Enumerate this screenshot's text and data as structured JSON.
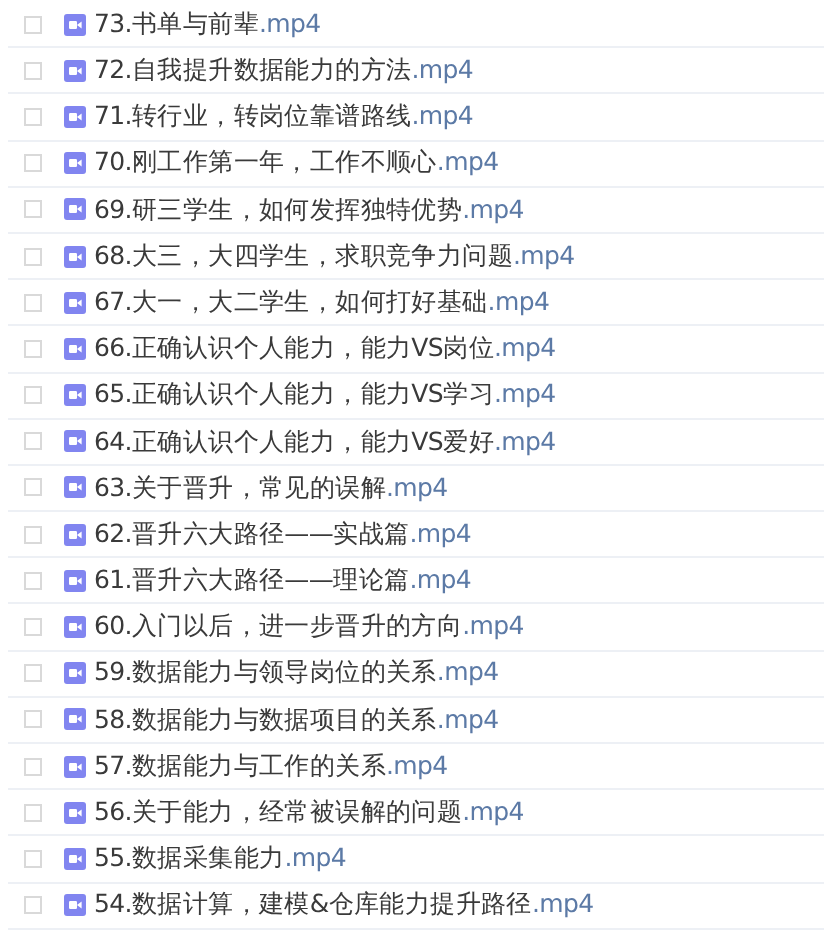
{
  "files": [
    {
      "name": "73.书单与前辈",
      "ext": ".mp4",
      "checked": false
    },
    {
      "name": "72.自我提升数据能力的方法",
      "ext": ".mp4",
      "checked": false
    },
    {
      "name": "71.转行业，转岗位靠谱路线",
      "ext": ".mp4",
      "checked": false
    },
    {
      "name": "70.刚工作第一年，工作不顺心",
      "ext": ".mp4",
      "checked": false
    },
    {
      "name": "69.研三学生，如何发挥独特优势",
      "ext": ".mp4",
      "checked": false
    },
    {
      "name": "68.大三，大四学生，求职竞争力问题",
      "ext": ".mp4",
      "checked": false
    },
    {
      "name": "67.大一，大二学生，如何打好基础",
      "ext": ".mp4",
      "checked": false
    },
    {
      "name": "66.正确认识个人能力，能力VS岗位",
      "ext": ".mp4",
      "checked": false
    },
    {
      "name": "65.正确认识个人能力，能力VS学习",
      "ext": ".mp4",
      "checked": false
    },
    {
      "name": "64.正确认识个人能力，能力VS爱好",
      "ext": ".mp4",
      "checked": false
    },
    {
      "name": "63.关于晋升，常见的误解",
      "ext": ".mp4",
      "checked": false
    },
    {
      "name": "62.晋升六大路径——实战篇",
      "ext": ".mp4",
      "checked": false
    },
    {
      "name": "61.晋升六大路径——理论篇",
      "ext": ".mp4",
      "checked": false
    },
    {
      "name": "60.入门以后，进一步晋升的方向",
      "ext": ".mp4",
      "checked": false
    },
    {
      "name": "59.数据能力与领导岗位的关系",
      "ext": ".mp4",
      "checked": false
    },
    {
      "name": "58.数据能力与数据项目的关系",
      "ext": ".mp4",
      "checked": false
    },
    {
      "name": "57.数据能力与工作的关系",
      "ext": ".mp4",
      "checked": false
    },
    {
      "name": "56.关于能力，经常被误解的问题",
      "ext": ".mp4",
      "checked": false
    },
    {
      "name": "55.数据采集能力",
      "ext": ".mp4",
      "checked": false
    },
    {
      "name": "54.数据计算，建模&仓库能力提升路径",
      "ext": ".mp4",
      "checked": false
    }
  ]
}
